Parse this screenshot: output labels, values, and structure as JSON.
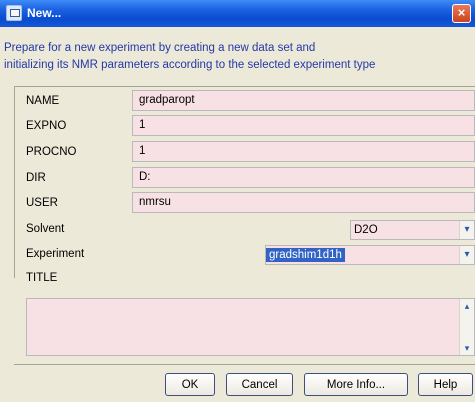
{
  "window": {
    "title": "New...",
    "close_glyph": "×"
  },
  "description": [
    "Prepare for a new experiment by creating a new data set and",
    "initializing its NMR parameters according to the selected experiment type"
  ],
  "fields": {
    "name": {
      "label": "NAME",
      "value": "gradparopt"
    },
    "expno": {
      "label": "EXPNO",
      "value": "1"
    },
    "procno": {
      "label": "PROCNO",
      "value": "1"
    },
    "dir": {
      "label": "DIR",
      "value": "D:"
    },
    "user": {
      "label": "USER",
      "value": "nmrsu"
    }
  },
  "solvent": {
    "label": "Solvent",
    "value": "D2O"
  },
  "experiment": {
    "label": "Experiment",
    "value": "gradshim1d1h"
  },
  "title_label": "TITLE",
  "title_text": "",
  "buttons": {
    "ok": "OK",
    "cancel": "Cancel",
    "more_info": "More Info...",
    "help": "Help"
  },
  "icons": {
    "dropdown": "▾",
    "scroll_up": "▴",
    "scroll_down": "▾"
  },
  "colors": {
    "field_bg": "#f8e1e5",
    "description": "#2339a8",
    "selection": "#3163c5",
    "titlebar": "#0a4ccf"
  }
}
